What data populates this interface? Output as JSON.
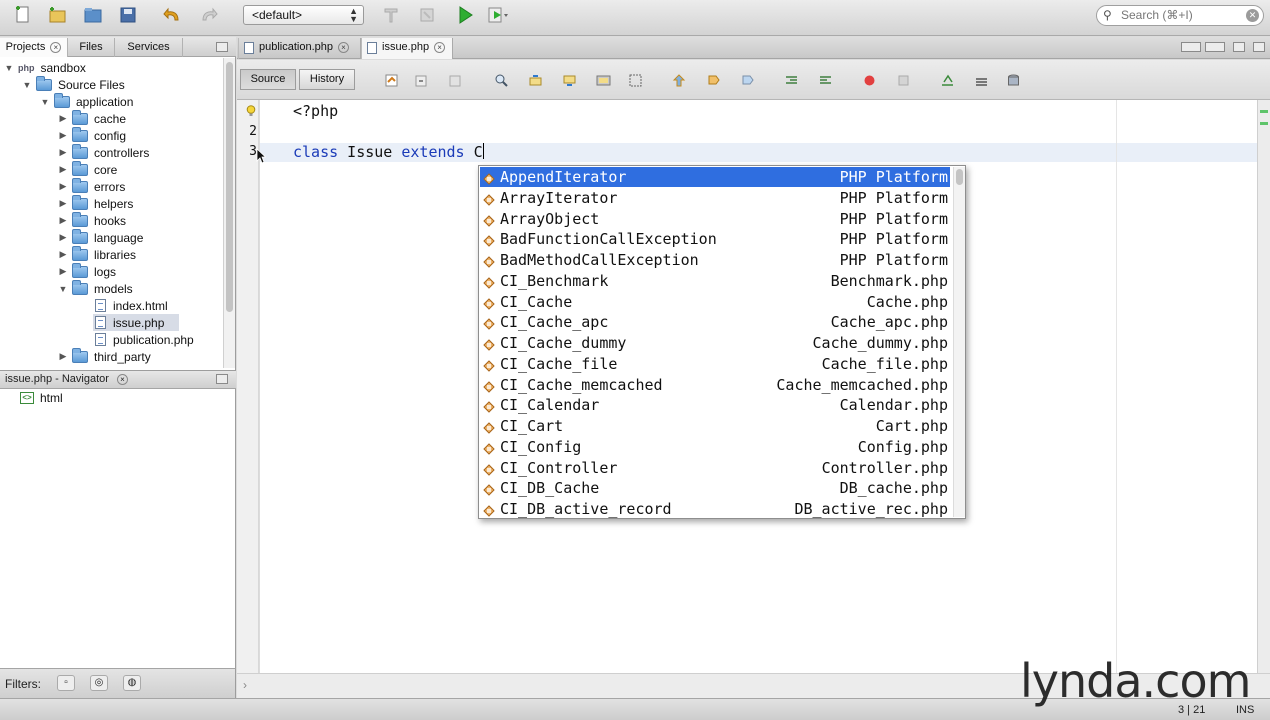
{
  "toolbar": {
    "config_select": "<default>",
    "search_placeholder": "Search (⌘+I)"
  },
  "projects_panel": {
    "tabs": [
      {
        "label": "Projects"
      },
      {
        "label": "Files"
      },
      {
        "label": "Services"
      }
    ],
    "tree": [
      {
        "label": "sandbox",
        "type": "project",
        "expanded": true
      },
      {
        "label": "Source Files",
        "type": "folder",
        "expanded": true
      },
      {
        "label": "application",
        "type": "folder",
        "expanded": true
      },
      {
        "label": "cache",
        "type": "folder",
        "expanded": false
      },
      {
        "label": "config",
        "type": "folder",
        "expanded": false
      },
      {
        "label": "controllers",
        "type": "folder",
        "expanded": false
      },
      {
        "label": "core",
        "type": "folder",
        "expanded": false
      },
      {
        "label": "errors",
        "type": "folder",
        "expanded": false
      },
      {
        "label": "helpers",
        "type": "folder",
        "expanded": false
      },
      {
        "label": "hooks",
        "type": "folder",
        "expanded": false
      },
      {
        "label": "language",
        "type": "folder",
        "expanded": false
      },
      {
        "label": "libraries",
        "type": "folder",
        "expanded": false
      },
      {
        "label": "logs",
        "type": "folder",
        "expanded": false
      },
      {
        "label": "models",
        "type": "folder",
        "expanded": true
      },
      {
        "label": "index.html",
        "type": "file"
      },
      {
        "label": "issue.php",
        "type": "file",
        "selected": true
      },
      {
        "label": "publication.php",
        "type": "file"
      },
      {
        "label": "third_party",
        "type": "folder",
        "expanded": false
      }
    ]
  },
  "navigator": {
    "title": "issue.php - Navigator",
    "items": [
      {
        "label": "html"
      }
    ]
  },
  "filters": {
    "label": "Filters:"
  },
  "editor": {
    "tabs": [
      {
        "label": "publication.php"
      },
      {
        "label": "issue.php",
        "active": true
      }
    ],
    "source_button": "Source",
    "history_button": "History",
    "line_numbers": [
      "1",
      "2",
      "3"
    ],
    "code": {
      "line1": "<?php",
      "line3_kw1": "class",
      "line3_name": " Issue ",
      "line3_kw2": "extends",
      "line3_typed": " C"
    }
  },
  "completion": {
    "items": [
      {
        "name": "AppendIterator",
        "source": "PHP Platform",
        "selected": true
      },
      {
        "name": "ArrayIterator",
        "source": "PHP Platform"
      },
      {
        "name": "ArrayObject",
        "source": "PHP Platform"
      },
      {
        "name": "BadFunctionCallException",
        "source": "PHP Platform"
      },
      {
        "name": "BadMethodCallException",
        "source": "PHP Platform"
      },
      {
        "name": "CI_Benchmark",
        "source": "Benchmark.php"
      },
      {
        "name": "CI_Cache",
        "source": "Cache.php"
      },
      {
        "name": "CI_Cache_apc",
        "source": "Cache_apc.php"
      },
      {
        "name": "CI_Cache_dummy",
        "source": "Cache_dummy.php"
      },
      {
        "name": "CI_Cache_file",
        "source": "Cache_file.php"
      },
      {
        "name": "CI_Cache_memcached",
        "source": "Cache_memcached.php"
      },
      {
        "name": "CI_Calendar",
        "source": "Calendar.php"
      },
      {
        "name": "CI_Cart",
        "source": "Cart.php"
      },
      {
        "name": "CI_Config",
        "source": "Config.php"
      },
      {
        "name": "CI_Controller",
        "source": "Controller.php"
      },
      {
        "name": "CI_DB_Cache",
        "source": "DB_cache.php"
      },
      {
        "name": "CI_DB_active_record",
        "source": "DB_active_rec.php"
      }
    ]
  },
  "status_bar": {
    "position": "3 | 21",
    "mode": "INS"
  },
  "watermark": {
    "text": "lynda.com"
  },
  "colors": {
    "selection": "#2f6ee0",
    "keyword": "#1b3bb8"
  }
}
